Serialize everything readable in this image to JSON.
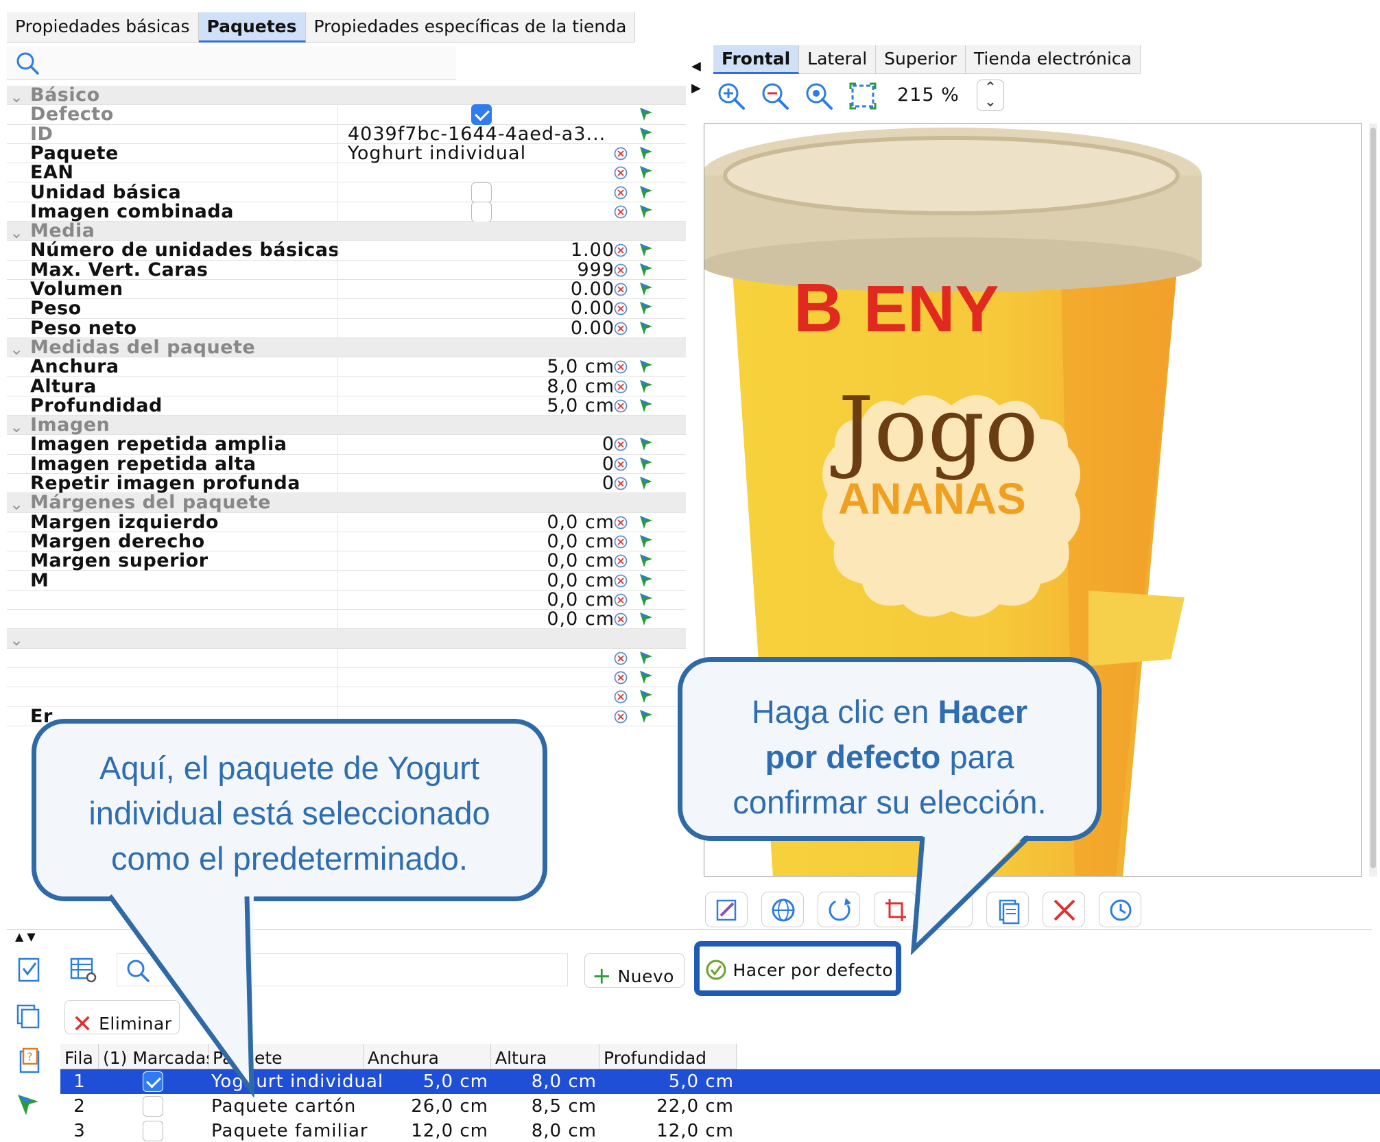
{
  "top_tabs": [
    "Propiedades básicas",
    "Paquetes",
    "Propiedades específicas de la tienda"
  ],
  "active_top_tab": "Paquetes",
  "property_rows": [
    {
      "type": "group",
      "label": "Básico"
    },
    {
      "type": "field",
      "label": "Defecto",
      "kind": "check",
      "checked": true,
      "muted": true,
      "icons": 1
    },
    {
      "type": "field",
      "label": "ID",
      "value": "4039f7bc-1644-4aed-a3...",
      "align": "left",
      "muted": true,
      "icons": 1
    },
    {
      "type": "field",
      "label": "Paquete",
      "value": "Yoghurt individual",
      "align": "left",
      "icons": 2
    },
    {
      "type": "field",
      "label": "EAN",
      "value": "",
      "icons": 2
    },
    {
      "type": "field",
      "label": "Unidad básica",
      "kind": "check",
      "checked": false,
      "icons": 2
    },
    {
      "type": "field",
      "label": "Imagen combinada",
      "kind": "check",
      "checked": false,
      "icons": 2
    },
    {
      "type": "group",
      "label": "Media"
    },
    {
      "type": "field",
      "label": "Número de unidades básicas",
      "value": "1.00",
      "align": "right",
      "icons": 2
    },
    {
      "type": "field",
      "label": "Max. Vert. Caras",
      "value": "999",
      "align": "right",
      "icons": 2
    },
    {
      "type": "field",
      "label": "Volumen",
      "value": "0.00",
      "align": "right",
      "icons": 2
    },
    {
      "type": "field",
      "label": "Peso",
      "value": "0.00",
      "align": "right",
      "icons": 2
    },
    {
      "type": "field",
      "label": "Peso neto",
      "value": "0.00",
      "align": "right",
      "icons": 2
    },
    {
      "type": "group",
      "label": "Medidas del paquete"
    },
    {
      "type": "field",
      "label": "Anchura",
      "value": "5,0 cm",
      "align": "right",
      "icons": 2
    },
    {
      "type": "field",
      "label": "Altura",
      "value": "8,0 cm",
      "align": "right",
      "icons": 2
    },
    {
      "type": "field",
      "label": "Profundidad",
      "value": "5,0 cm",
      "align": "right",
      "icons": 2
    },
    {
      "type": "group",
      "label": "Imagen"
    },
    {
      "type": "field",
      "label": "Imagen repetida amplia",
      "value": "0",
      "align": "right",
      "icons": 2
    },
    {
      "type": "field",
      "label": "Imagen repetida alta",
      "value": "0",
      "align": "right",
      "icons": 2
    },
    {
      "type": "field",
      "label": "Repetir imagen profunda",
      "value": "0",
      "align": "right",
      "icons": 2
    },
    {
      "type": "group",
      "label": "Márgenes del paquete"
    },
    {
      "type": "field",
      "label": "Margen izquierdo",
      "value": "0,0 cm",
      "align": "right",
      "icons": 2
    },
    {
      "type": "field",
      "label": "Margen derecho",
      "value": "0,0 cm",
      "align": "right",
      "icons": 2
    },
    {
      "type": "field",
      "label": "Margen superior",
      "value": "0,0 cm",
      "align": "right",
      "icons": 2
    },
    {
      "type": "field",
      "label": "M",
      "value": "0,0 cm",
      "align": "right",
      "icons": 2
    },
    {
      "type": "field",
      "label": "",
      "value": "0,0 cm",
      "align": "right",
      "icons": 2
    },
    {
      "type": "field",
      "label": "",
      "value": "0,0 cm",
      "align": "right",
      "icons": 2
    },
    {
      "type": "group",
      "label": ""
    },
    {
      "type": "field",
      "label": "",
      "value": "",
      "icons": 2
    },
    {
      "type": "field",
      "label": "",
      "value": "",
      "icons": 2
    },
    {
      "type": "field",
      "label": "",
      "value": "",
      "icons": 2
    },
    {
      "type": "field",
      "label": "Er",
      "value": "",
      "icons": 2
    }
  ],
  "view_tabs": [
    "Frontal",
    "Lateral",
    "Superior",
    "Tienda electrónica"
  ],
  "active_view_tab": "Frontal",
  "zoom": "215 %",
  "product_image": {
    "brand": "ENY",
    "brand_initial": "B",
    "name": "Jogo",
    "flavor": "ANANAS"
  },
  "buttons": {
    "nuevo": "Nuevo",
    "hacer_por_defecto": "Hacer por defecto",
    "eliminar": "Eliminar"
  },
  "table": {
    "headers": [
      "Fila",
      "(1) Marcadas",
      "Paquete",
      "Anchura",
      "Altura",
      "Profundidad"
    ],
    "rows": [
      {
        "fila": "1",
        "marcada": true,
        "paquete": "Yoghurt individual",
        "anchura": "5,0 cm",
        "altura": "8,0 cm",
        "profundidad": "5,0 cm",
        "selected": true
      },
      {
        "fila": "2",
        "marcada": false,
        "paquete": "Paquete cartón",
        "anchura": "26,0 cm",
        "altura": "8,5 cm",
        "profundidad": "22,0 cm",
        "selected": false
      },
      {
        "fila": "3",
        "marcada": false,
        "paquete": "Paquete familiar",
        "anchura": "12,0 cm",
        "altura": "8,0 cm",
        "profundidad": "12,0 cm",
        "selected": false
      }
    ]
  },
  "callouts": {
    "left": {
      "line1": "Aquí, el paquete de Yogurt",
      "line2": "individual está seleccionado",
      "line3": "como el predeterminado."
    },
    "right": {
      "pre": "Haga clic en ",
      "bold1": "Hacer",
      "bold2": "por defecto",
      "post1": " para",
      "line3": "confirmar su elección."
    }
  },
  "colors": {
    "accent": "#2f7cf0",
    "selection": "#1f4fd6",
    "callout_border": "#2f6aa6",
    "callout_text": "#2d6db0",
    "cup_yellow": "#f6c93a",
    "brand_red": "#e02a1f",
    "jogo_brown": "#6b3d12",
    "ananas_orange": "#f0a020"
  }
}
